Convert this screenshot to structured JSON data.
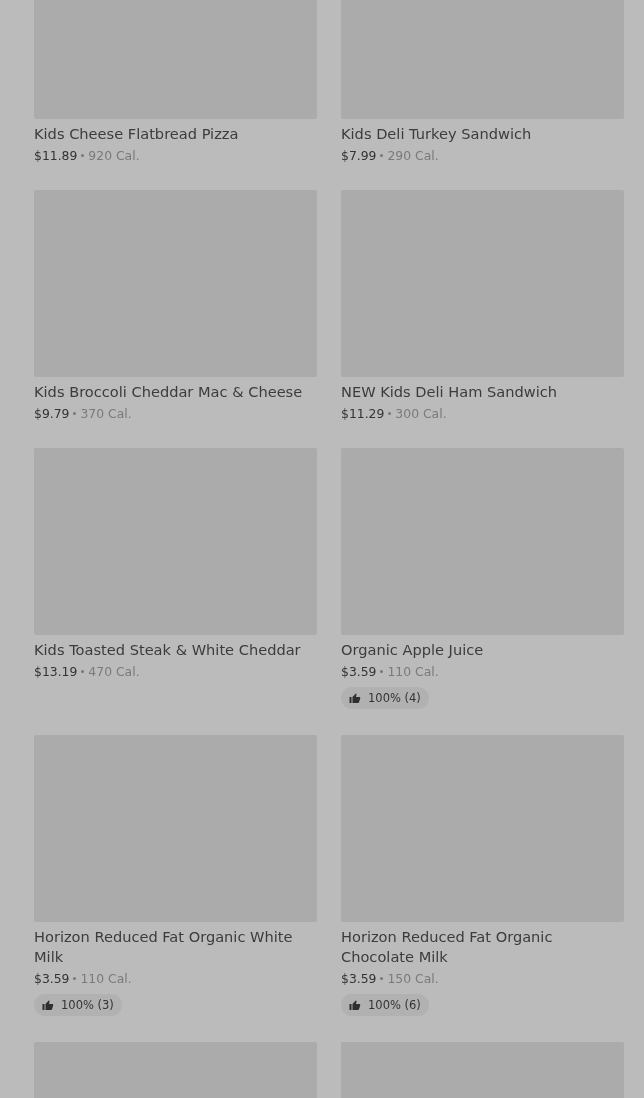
{
  "items": [
    {
      "kind": "full",
      "name": "Kids Cheese Flatbread Pizza",
      "price": "$11.89",
      "calories": "920 Cal."
    },
    {
      "kind": "full",
      "name": "Kids Deli Turkey Sandwich",
      "price": "$7.99",
      "calories": "290 Cal."
    },
    {
      "kind": "full",
      "name": "Kids Broccoli Cheddar Mac & Cheese",
      "price": "$9.79",
      "calories": "370 Cal."
    },
    {
      "kind": "full",
      "name": "NEW Kids Deli Ham Sandwich",
      "price": "$11.29",
      "calories": "300 Cal."
    },
    {
      "kind": "full",
      "name": "Kids Toasted Steak & White Cheddar",
      "price": "$13.19",
      "calories": "470 Cal."
    },
    {
      "kind": "full",
      "name": "Organic Apple Juice",
      "price": "$3.59",
      "calories": "110 Cal.",
      "rating": "100% (4)"
    },
    {
      "kind": "full",
      "name": "Horizon Reduced Fat Organic White Milk",
      "price": "$3.59",
      "calories": "110 Cal.",
      "rating": "100% (3)"
    },
    {
      "kind": "full",
      "name": "Horizon Reduced Fat Organic Chocolate Milk",
      "price": "$3.59",
      "calories": "150 Cal.",
      "rating": "100% (6)"
    },
    {
      "kind": "image-only"
    },
    {
      "kind": "image-only"
    }
  ]
}
